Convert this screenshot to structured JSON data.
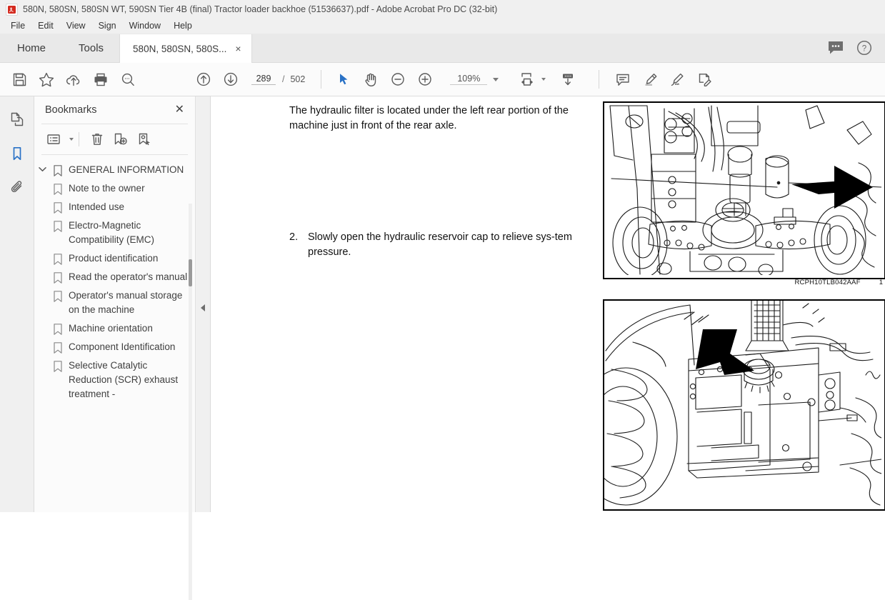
{
  "window": {
    "title": "580N, 580SN, 580SN WT, 590SN Tier 4B (final) Tractor loader backhoe (51536637).pdf - Adobe Acrobat Pro DC (32-bit)",
    "app_icon": "acrobat-icon"
  },
  "menu": {
    "items": [
      "File",
      "Edit",
      "View",
      "Sign",
      "Window",
      "Help"
    ]
  },
  "tabs": {
    "home_label": "Home",
    "tools_label": "Tools",
    "document_label": "580N, 580SN, 580S...",
    "close_label": "×",
    "right_icons": [
      "comment-icon",
      "help-icon"
    ]
  },
  "toolbar": {
    "icons": [
      "save-icon",
      "star-icon",
      "upload-cloud-icon",
      "print-icon",
      "search-icon",
      "previous-page-icon",
      "next-page-icon",
      "select-tool-icon",
      "hand-tool-icon",
      "zoom-out-icon",
      "zoom-in-icon",
      "fit-page-icon",
      "scroll-mode-icon",
      "comment-tool-icon",
      "highlight-tool-icon",
      "sign-tool-icon",
      "fill-and-sign-icon"
    ],
    "page_current": "289",
    "page_separator": "/",
    "page_total": "502",
    "zoom_level": "109%"
  },
  "rail": {
    "items": [
      "page-thumbnails-icon",
      "bookmarks-icon",
      "attachments-icon"
    ],
    "active": "bookmarks-icon"
  },
  "panel": {
    "title": "Bookmarks",
    "close_label": "✕",
    "tools": [
      "bookmark-options-icon",
      "delete-bookmark-icon",
      "new-bookmark-icon",
      "bookmark-from-selection-icon"
    ],
    "bookmarks": [
      {
        "label": "GENERAL INFORMATION",
        "level": 0,
        "expanded": true
      },
      {
        "label": "Note to the owner",
        "level": 1
      },
      {
        "label": "Intended use",
        "level": 1
      },
      {
        "label": "Electro-Magnetic Compatibility (EMC)",
        "level": 1
      },
      {
        "label": "Product identification",
        "level": 1
      },
      {
        "label": "Read the operator's manual",
        "level": 1
      },
      {
        "label": "Operator's manual storage on the machine",
        "level": 1
      },
      {
        "label": "Machine orientation",
        "level": 1
      },
      {
        "label": "Component Identification",
        "level": 1
      },
      {
        "label": "Selective Catalytic Reduction (SCR) exhaust treatment -",
        "level": 1
      }
    ]
  },
  "document": {
    "paragraph": "The hydraulic filter is located under the left rear portion of the machine just in front of the rear axle.",
    "step_number": "2.",
    "step_text": "Slowly open the hydraulic reservoir cap to relieve sys-tem pressure.",
    "figure1": {
      "caption_code": "RCPH10TLB042AAF",
      "caption_number": "1",
      "alt": "rear-axle-hydraulic-filter-illustration"
    },
    "figure2": {
      "alt": "hydraulic-reservoir-cap-illustration"
    }
  },
  "colors": {
    "accent": "#2a72c6",
    "titlebar_bg": "#f0f0f0",
    "tabbar_bg": "#e9e9e9",
    "toolbar_bg": "#fbfbfb",
    "panel_bg": "#fbfbfb",
    "icon_gray": "#5c5c5c"
  }
}
